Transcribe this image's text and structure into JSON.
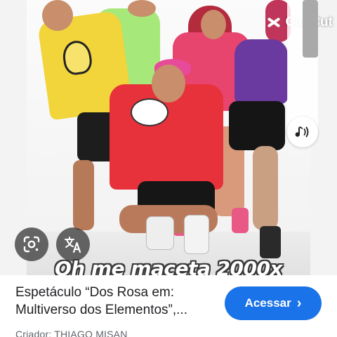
{
  "overlay": {
    "watermark_text": "CapCut",
    "caption": "Oh me maceta 2000x"
  },
  "icons": {
    "lens": "lens-icon",
    "translate": "translate-icon",
    "audio": "audio-icon",
    "capcut": "capcut-logo-icon",
    "chevron": "chevron-right-icon"
  },
  "result": {
    "title_line1": "Espetáculo “Dos Rosa em:",
    "title_line2": "Multiverso dos Elementos”,...",
    "creator": "Criador: THIAGO MISAN",
    "action_label": "Acessar",
    "action_chevron": "›"
  },
  "colors": {
    "accent": "#1a73e8",
    "title_text": "#202124",
    "secondary_text": "#5f6368"
  }
}
